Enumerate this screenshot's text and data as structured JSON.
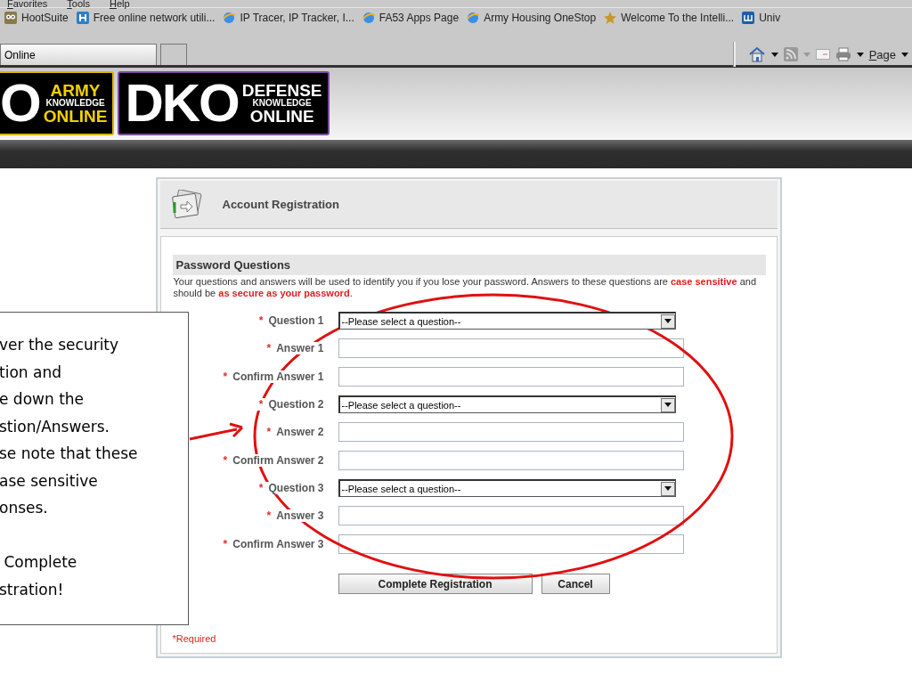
{
  "menu_bar": {
    "items": [
      "Favorites",
      "Tools",
      "Help"
    ]
  },
  "favorites_bar": {
    "items": [
      "HootSuite",
      "Free online network utili...",
      "IP Tracer, IP Tracker, I...",
      "FA53 Apps Page",
      "Army Housing OneStop",
      "Welcome To the Intelli...",
      "Univ"
    ]
  },
  "tabs": [
    {
      "label": "Online",
      "selected": true
    },
    {
      "selected": false
    }
  ],
  "command_bar": {
    "page_menu": "Page"
  },
  "banner": {
    "ako_logo": {
      "big": "O",
      "line_1": "ARMY",
      "line_2": "KNOWLEDGE",
      "line_3": "ONLINE"
    },
    "dko_logo": {
      "big": "DKO",
      "line_1": "DEFENSE",
      "line_2": "KNOWLEDGE",
      "line_3": "ONLINE"
    }
  },
  "panel": {
    "title": "Account Registration",
    "section_title": "Password Questions",
    "description": "Your questions and answers will be used to identify you if you lose your password. Answers to these questions are **case sensitive** and should be **as secure as your password**.",
    "fields": [
      {
        "kind": "select",
        "mark": "*",
        "label": "Question 1",
        "value": "--Please select a question--"
      },
      {
        "kind": "text",
        "mark": "*",
        "label": "Answer 1"
      },
      {
        "kind": "text",
        "mark": "*",
        "label": "Confirm Answer 1"
      },
      {
        "kind": "select",
        "mark": "*",
        "label": "Question 2",
        "value": "--Please select a question--"
      },
      {
        "kind": "text",
        "mark": "*",
        "label": "Answer 2"
      },
      {
        "kind": "text",
        "mark": "*",
        "label": "Confirm Answer 2"
      },
      {
        "kind": "select",
        "mark": "*",
        "label": "Question 3",
        "value": "--Please select a question--"
      },
      {
        "kind": "text",
        "mark": "*",
        "label": "Answer 3"
      },
      {
        "kind": "text",
        "mark": "*",
        "label": "Confirm Answer 3"
      }
    ],
    "buttons": [
      "Complete Registration",
      "Cancel"
    ],
    "required_note": "*Required"
  },
  "callout": {
    "paragraphs": [
      [
        "ver the security",
        "tion and",
        "e down the",
        "stion/Answers.",
        "se note that these",
        "ase sensitive",
        "onses."
      ],
      [
        " Complete",
        "stration!"
      ]
    ]
  }
}
